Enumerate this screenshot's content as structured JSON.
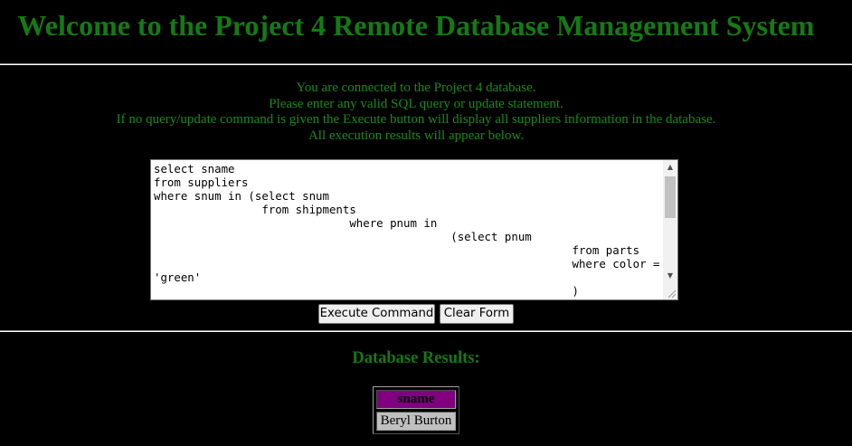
{
  "header": {
    "title": "Welcome to the Project 4 Remote Database Management System"
  },
  "intro": {
    "lines": [
      "You are connected to the Project 4 database.",
      "Please enter any valid SQL query or update statement.",
      "If no query/update command is given the Execute button will display all suppliers information in the database.",
      "All execution results will appear below."
    ]
  },
  "query": {
    "value": "select sname\nfrom suppliers\nwhere snum in (select snum\n                from shipments\n                             where pnum in\n                                            (select pnum\n                                                              from parts\n                                                              where color =\n'green'\n                                                              )"
  },
  "buttons": {
    "execute_label": "Execute Command",
    "clear_label": "Clear Form"
  },
  "results": {
    "heading": "Database Results:",
    "columns": [
      "sname"
    ],
    "rows": [
      [
        "Beryl Burton"
      ]
    ]
  },
  "colors": {
    "background": "#000000",
    "text_green": "#1a8a1a",
    "header_cell": "#800080",
    "data_cell": "#c0c0c0"
  },
  "icons": [
    "scroll-up-arrow-icon",
    "scroll-down-arrow-icon",
    "resize-grip-icon"
  ]
}
